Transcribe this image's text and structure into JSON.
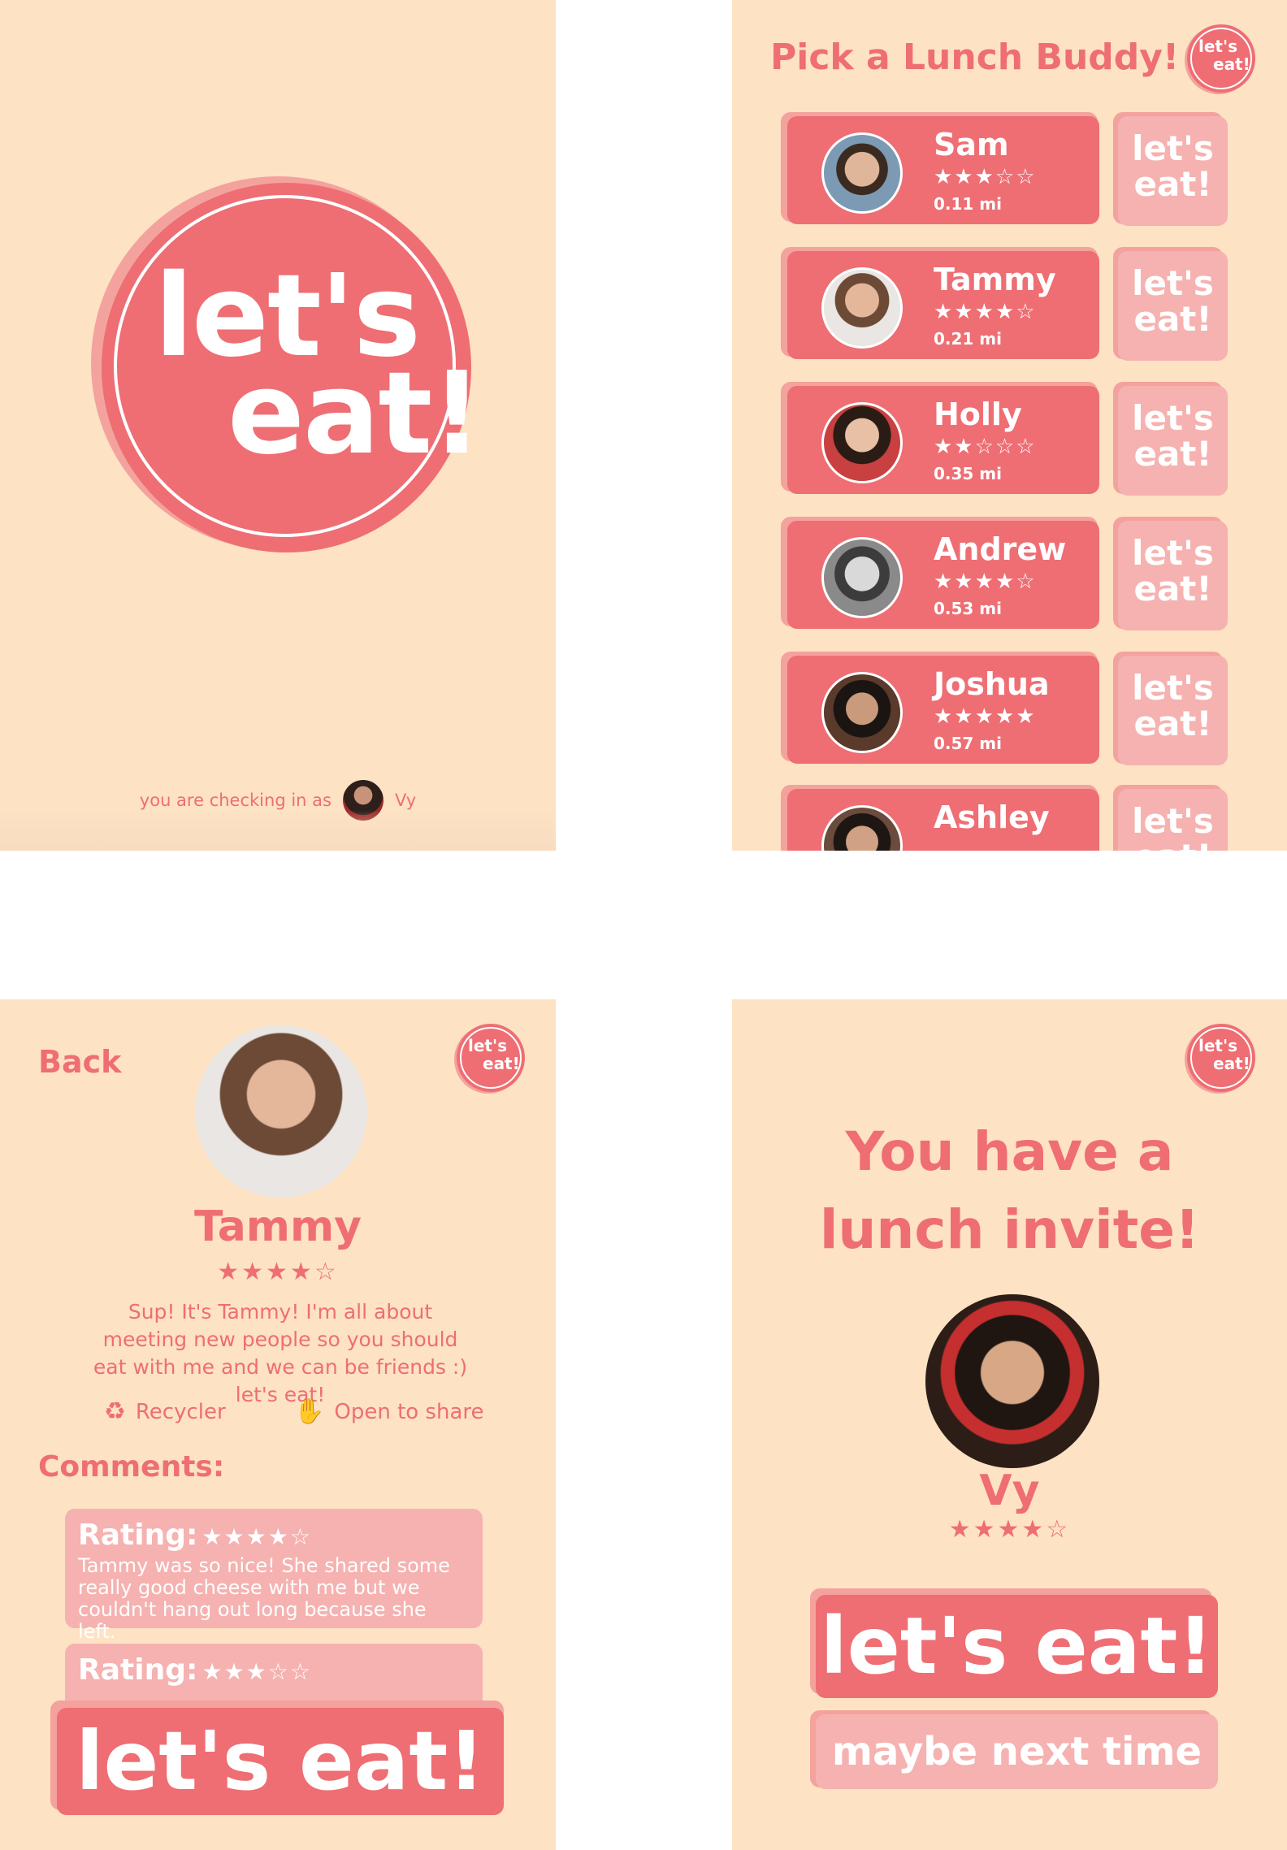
{
  "splash": {
    "logo_line1": "let's",
    "logo_line2": "eat!",
    "checkin_text": "you are checking in as",
    "checkin_user": "Vy"
  },
  "logo_small": {
    "line1": "let's",
    "line2": "eat!"
  },
  "list": {
    "title": "Pick a Lunch Buddy!",
    "button_line1": "let's",
    "button_line2": "eat!",
    "buddies": [
      {
        "name": "Sam",
        "stars": "★★★☆☆",
        "distance": "0.11 mi"
      },
      {
        "name": "Tammy",
        "stars": "★★★★☆",
        "distance": "0.21 mi"
      },
      {
        "name": "Holly",
        "stars": "★★☆☆☆",
        "distance": "0.35 mi"
      },
      {
        "name": "Andrew",
        "stars": "★★★★☆",
        "distance": "0.53 mi"
      },
      {
        "name": "Joshua",
        "stars": "★★★★★",
        "distance": "0.57 mi"
      },
      {
        "name": "Ashley",
        "stars": "",
        "distance": ""
      }
    ]
  },
  "profile": {
    "back_label": "Back",
    "name": "Tammy",
    "stars": "★★★★☆",
    "bio": "Sup! It's Tammy! I'm all about meeting new people so you should eat with me and we can be friends :) let's eat!",
    "tag1": "Recycler",
    "tag2": "Open to share",
    "comments_title": "Comments:",
    "comments": [
      {
        "label": "Rating:",
        "stars": "★★★★☆",
        "text": "Tammy was so nice! She shared some really good cheese with me but we couldn't hang out long because she left."
      },
      {
        "label": "Rating:",
        "stars": "★★★☆☆",
        "text": ""
      }
    ],
    "cta": "let's eat!"
  },
  "invite": {
    "title": "You have a lunch invite!",
    "name": "Vy",
    "stars": "★★★★☆",
    "accept": "let's eat!",
    "decline": "maybe next time"
  },
  "colors": {
    "background": "#fde2c4",
    "coral": "#ee6e73",
    "light_coral": "#f5b2b0",
    "shadow": "#f4a29d"
  },
  "icons": [
    "recycle-icon",
    "hands-icon",
    "star-icon"
  ]
}
